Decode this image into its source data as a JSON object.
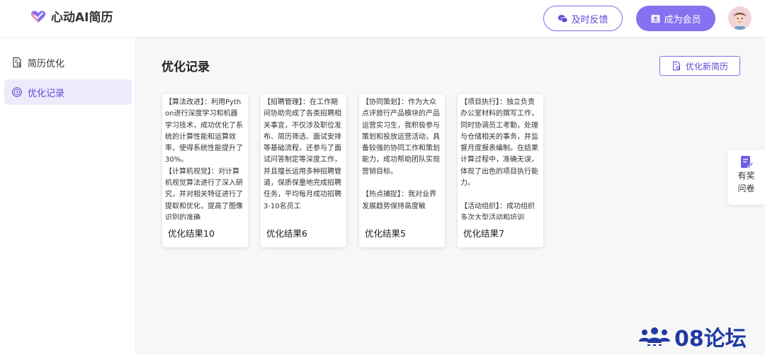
{
  "header": {
    "logo_text": "心动AI简历",
    "feedback_label": "及时反馈",
    "member_label": "成为会员"
  },
  "sidebar": {
    "items": [
      {
        "label": "简历优化",
        "icon": "document-search-icon",
        "active": false
      },
      {
        "label": "优化记录",
        "icon": "history-record-icon",
        "active": true
      }
    ]
  },
  "main": {
    "title": "优化记录",
    "new_button_label": "优化新简历",
    "cards": [
      {
        "body": "【算法改进】：利用Python进行深度学习和机器学习技术，成功优化了系统的计算性能和运算效率，使得系统性能提升了30%。\n【计算机视觉】：对计算机视觉算法进行了深入研究，并对相关特征进行了提取和优化，提高了图像识别的准确",
        "title": "优化结果10"
      },
      {
        "body": "【招聘管理】：在工作期间协助完成了各类招聘相关事宜，不仅涉及职位发布、简历筛选、面试安排等基础流程，还参与了面试问答制定等深度工作，并且擅长运用多种招聘管道，保质保量地完成招聘任务，平均每月成功招聘3-10名员工",
        "title": "优化结果6"
      },
      {
        "body": "【协同策划】：作为大众点评旅行产品模块的产品运营实习生，我积极参与策划和投放运营活动，具备较强的协同工作和策划能力，成功帮助团队实现营销目标。\n\n【热点捕捉】：我对业界发展趋势保持高度敏",
        "title": "优化结果5"
      },
      {
        "body": "【项目执行】：独立负责办公室材料的撰写工作，同时协调员工考勤，处理与仓储相关的事务，并监督月度报表编制。在结果计算过程中，准确无误，体现了出色的项目执行能力。\n\n【活动组织】：成功组织多次大型活动和培训",
        "title": "优化结果7"
      }
    ]
  },
  "float_panel": {
    "line1": "有奖",
    "line2": "问卷"
  },
  "watermark": {
    "text": "08论坛"
  },
  "colors": {
    "accent": "#8572f0",
    "accent_text": "#5b4ad6",
    "active_bg": "#edeafc"
  }
}
